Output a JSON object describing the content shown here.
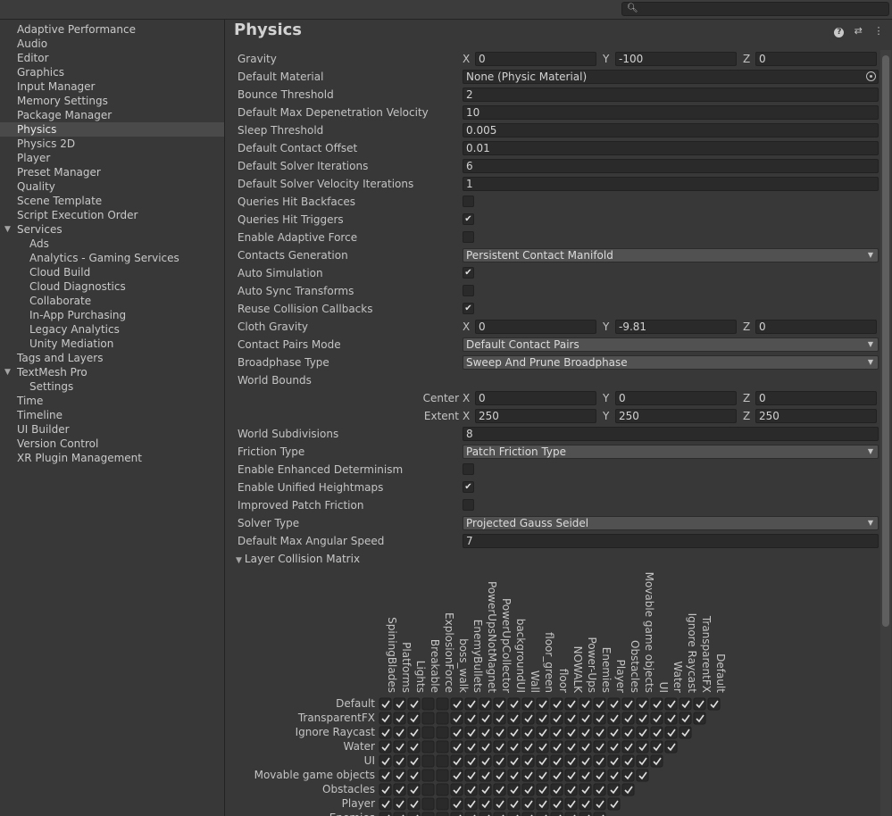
{
  "search": {
    "placeholder": "",
    "icon": "search-icon"
  },
  "sidebar": {
    "items": [
      {
        "label": "Adaptive Performance",
        "level": 0
      },
      {
        "label": "Audio",
        "level": 0
      },
      {
        "label": "Editor",
        "level": 0
      },
      {
        "label": "Graphics",
        "level": 0
      },
      {
        "label": "Input Manager",
        "level": 0
      },
      {
        "label": "Memory Settings",
        "level": 0
      },
      {
        "label": "Package Manager",
        "level": 0
      },
      {
        "label": "Physics",
        "level": 0,
        "selected": true
      },
      {
        "label": "Physics 2D",
        "level": 0
      },
      {
        "label": "Player",
        "level": 0
      },
      {
        "label": "Preset Manager",
        "level": 0
      },
      {
        "label": "Quality",
        "level": 0
      },
      {
        "label": "Scene Template",
        "level": 0
      },
      {
        "label": "Script Execution Order",
        "level": 0
      },
      {
        "label": "Services",
        "level": 0,
        "expanded": true
      },
      {
        "label": "Ads",
        "level": 1
      },
      {
        "label": "Analytics - Gaming Services",
        "level": 1
      },
      {
        "label": "Cloud Build",
        "level": 1
      },
      {
        "label": "Cloud Diagnostics",
        "level": 1
      },
      {
        "label": "Collaborate",
        "level": 1
      },
      {
        "label": "In-App Purchasing",
        "level": 1
      },
      {
        "label": "Legacy Analytics",
        "level": 1
      },
      {
        "label": "Unity Mediation",
        "level": 1
      },
      {
        "label": "Tags and Layers",
        "level": 0
      },
      {
        "label": "TextMesh Pro",
        "level": 0,
        "expanded": true
      },
      {
        "label": "Settings",
        "level": 1
      },
      {
        "label": "Time",
        "level": 0
      },
      {
        "label": "Timeline",
        "level": 0
      },
      {
        "label": "UI Builder",
        "level": 0
      },
      {
        "label": "Version Control",
        "level": 0
      },
      {
        "label": "XR Plugin Management",
        "level": 0
      }
    ]
  },
  "main": {
    "title": "Physics",
    "header_icons": [
      "help-icon",
      "sliders-icon",
      "more-vert-icon"
    ],
    "fields": [
      {
        "type": "vec3",
        "label": "Gravity",
        "x": "0",
        "y": "-100",
        "z": "0"
      },
      {
        "type": "object",
        "label": "Default Material",
        "value": "None (Physic Material)"
      },
      {
        "type": "text",
        "label": "Bounce Threshold",
        "value": "2"
      },
      {
        "type": "text",
        "label": "Default Max Depenetration Velocity",
        "value": "10"
      },
      {
        "type": "text",
        "label": "Sleep Threshold",
        "value": "0.005"
      },
      {
        "type": "text",
        "label": "Default Contact Offset",
        "value": "0.01"
      },
      {
        "type": "text",
        "label": "Default Solver Iterations",
        "value": "6"
      },
      {
        "type": "text",
        "label": "Default Solver Velocity Iterations",
        "value": "1"
      },
      {
        "type": "check",
        "label": "Queries Hit Backfaces",
        "checked": false
      },
      {
        "type": "check",
        "label": "Queries Hit Triggers",
        "checked": true
      },
      {
        "type": "check",
        "label": "Enable Adaptive Force",
        "checked": false
      },
      {
        "type": "dropdown",
        "label": "Contacts Generation",
        "value": "Persistent Contact Manifold"
      },
      {
        "type": "check",
        "label": "Auto Simulation",
        "checked": true
      },
      {
        "type": "check",
        "label": "Auto Sync Transforms",
        "checked": false
      },
      {
        "type": "check",
        "label": "Reuse Collision Callbacks",
        "checked": true
      },
      {
        "type": "vec3",
        "label": "Cloth Gravity",
        "x": "0",
        "y": "-9.81",
        "z": "0"
      },
      {
        "type": "dropdown",
        "label": "Contact Pairs Mode",
        "value": "Default Contact Pairs"
      },
      {
        "type": "dropdown",
        "label": "Broadphase Type",
        "value": "Sweep And Prune Broadphase"
      },
      {
        "type": "header",
        "label": "World Bounds"
      },
      {
        "type": "vec3",
        "label": "Center",
        "sub": true,
        "x": "0",
        "y": "0",
        "z": "0"
      },
      {
        "type": "vec3",
        "label": "Extent",
        "sub": true,
        "x": "250",
        "y": "250",
        "z": "250"
      },
      {
        "type": "text",
        "label": "World Subdivisions",
        "value": "8"
      },
      {
        "type": "dropdown",
        "label": "Friction Type",
        "value": "Patch Friction Type"
      },
      {
        "type": "check",
        "label": "Enable Enhanced Determinism",
        "checked": false
      },
      {
        "type": "check",
        "label": "Enable Unified Heightmaps",
        "checked": true
      },
      {
        "type": "check",
        "label": "Improved Patch Friction",
        "checked": false
      },
      {
        "type": "dropdown",
        "label": "Solver Type",
        "value": "Projected Gauss Seidel"
      },
      {
        "type": "text",
        "label": "Default Max Angular Speed",
        "value": "7"
      }
    ],
    "axis_labels": {
      "x": "X",
      "y": "Y",
      "z": "Z"
    },
    "collision_matrix": {
      "title": "Layer Collision Matrix",
      "columns": [
        "SpiningBlades",
        "Platforms",
        "Lights",
        "Breakable",
        "ExplosionForce",
        "boss_walk",
        "EnemyBullets",
        "PowerUpsNotMagnet",
        "PowerUpCollector",
        "backgroundUI",
        "Wall",
        "floor_green",
        "floor",
        "NOWALK",
        "Power-Ups",
        "Enemies",
        "Player",
        "Obstacles",
        "Movable game objects",
        "UI",
        "Water",
        "Ignore Raycast",
        "TransparentFX",
        "Default"
      ],
      "rows": [
        "Default",
        "TransparentFX",
        "Ignore Raycast",
        "Water",
        "UI",
        "Movable game objects",
        "Obstacles",
        "Player",
        "Enemies"
      ],
      "unchecked_columns": [
        "Breakable",
        "ExplosionForce"
      ]
    }
  }
}
